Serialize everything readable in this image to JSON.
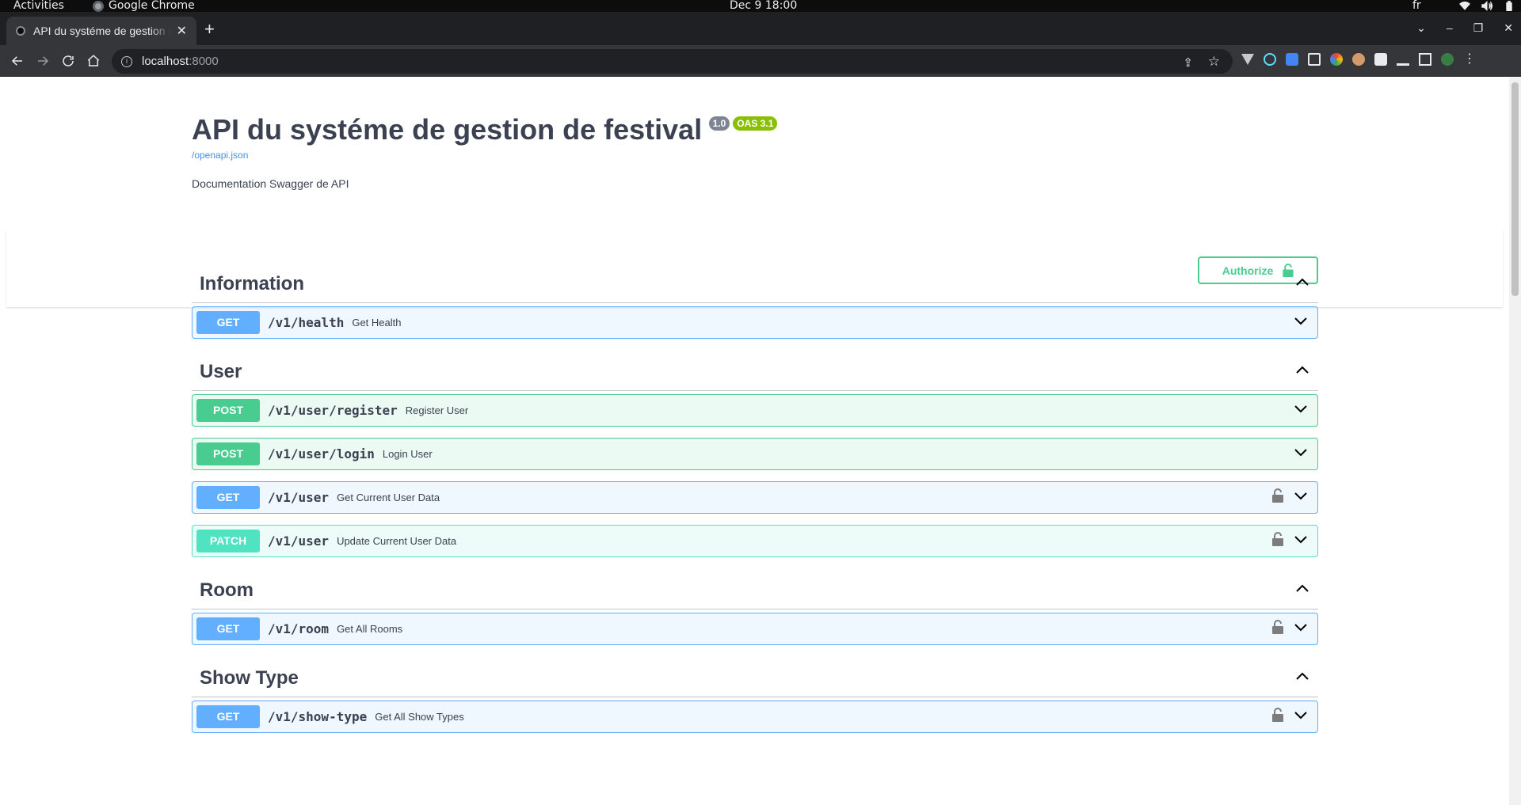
{
  "os_bar": {
    "activities": "Activities",
    "app_name": "Google Chrome",
    "clock": "Dec 9  18:00",
    "lang": "fr"
  },
  "browser": {
    "tab_title": "API du systéme de gestion de festival",
    "url_host": "localhost",
    "url_port": ":8000"
  },
  "swagger": {
    "title": "API du systéme de gestion de festival",
    "version": "1.0",
    "oas": "OAS 3.1",
    "spec_link": "/openapi.json",
    "description": "Documentation Swagger de API",
    "authorize_label": "Authorize"
  },
  "tags": [
    {
      "name": "Information",
      "operations": [
        {
          "method": "GET",
          "path": "/v1/health",
          "summary": "Get Health",
          "locked": false
        }
      ]
    },
    {
      "name": "User",
      "operations": [
        {
          "method": "POST",
          "path": "/v1/user/register",
          "summary": "Register User",
          "locked": false
        },
        {
          "method": "POST",
          "path": "/v1/user/login",
          "summary": "Login User",
          "locked": false
        },
        {
          "method": "GET",
          "path": "/v1/user",
          "summary": "Get Current User Data",
          "locked": true
        },
        {
          "method": "PATCH",
          "path": "/v1/user",
          "summary": "Update Current User Data",
          "locked": true
        }
      ]
    },
    {
      "name": "Room",
      "operations": [
        {
          "method": "GET",
          "path": "/v1/room",
          "summary": "Get All Rooms",
          "locked": true
        }
      ]
    },
    {
      "name": "Show Type",
      "operations": [
        {
          "method": "GET",
          "path": "/v1/show-type",
          "summary": "Get All Show Types",
          "locked": true
        }
      ]
    }
  ],
  "colors": {
    "get": "#61affe",
    "post": "#49cc90",
    "patch": "#50e3c2",
    "authorize": "#49cc90",
    "version_badge": "#7d8492",
    "oas_badge": "#89bf04"
  }
}
